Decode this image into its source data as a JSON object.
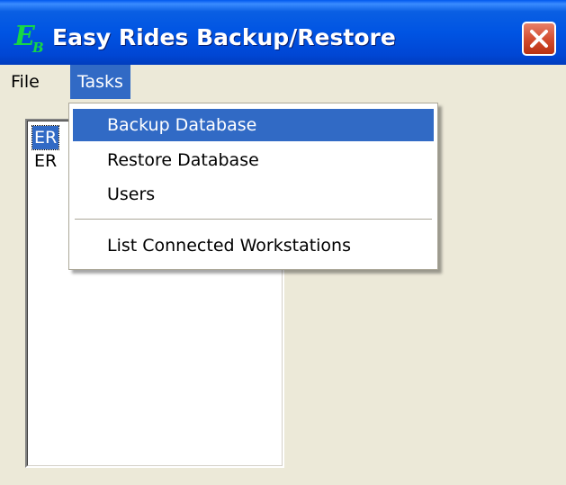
{
  "window": {
    "title": "Easy Rides Backup/Restore",
    "icon": {
      "name": "easy-rides-logo-icon",
      "letter": "E",
      "sub": "B",
      "color": "#16d646"
    },
    "title_color": "#0054e3"
  },
  "menubar": {
    "items": [
      {
        "label": "File"
      },
      {
        "label": "Tasks"
      }
    ]
  },
  "tasks_menu": {
    "items": [
      {
        "label": "Backup Database"
      },
      {
        "label": "Restore Database"
      },
      {
        "label": "Users"
      },
      {
        "label": "List Connected Workstations"
      }
    ]
  },
  "list": {
    "items": [
      {
        "label": "ER"
      },
      {
        "label": "ER"
      }
    ]
  },
  "colors": {
    "selection": "#316ac5",
    "window_bg": "#ece9d8",
    "close_button": "#d24a2c"
  }
}
